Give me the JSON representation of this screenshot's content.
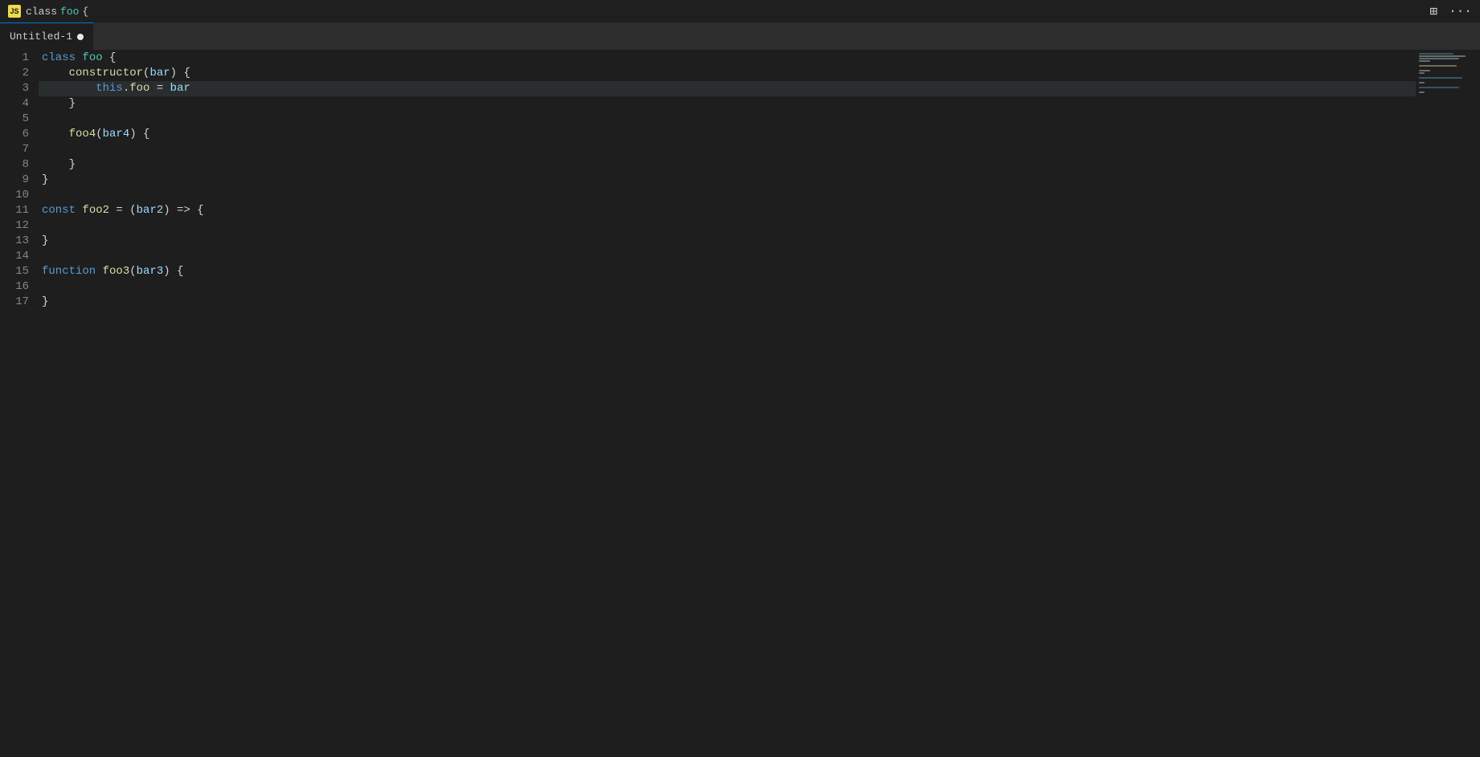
{
  "titleBar": {
    "jsIconLabel": "JS",
    "breadcrumb": {
      "classKeyword": "class",
      "className": "foo",
      "brace": "{"
    },
    "tabName": "Untitled-1",
    "tabModified": true
  },
  "icons": {
    "splitEditor": "⊞",
    "more": "···"
  },
  "lines": [
    {
      "num": 1,
      "content": "class foo {",
      "tokens": [
        {
          "t": "kw",
          "v": "class"
        },
        {
          "t": "text",
          "v": " "
        },
        {
          "t": "cn",
          "v": "foo"
        },
        {
          "t": "text",
          "v": " {"
        }
      ]
    },
    {
      "num": 2,
      "content": "    constructor(bar) {",
      "tokens": [
        {
          "t": "text",
          "v": "    "
        },
        {
          "t": "fn",
          "v": "constructor"
        },
        {
          "t": "punct",
          "v": "("
        },
        {
          "t": "param",
          "v": "bar"
        },
        {
          "t": "punct",
          "v": ") {"
        }
      ]
    },
    {
      "num": 3,
      "content": "        this.foo = bar",
      "tokens": [
        {
          "t": "text",
          "v": "        "
        },
        {
          "t": "kw-this",
          "v": "this"
        },
        {
          "t": "text",
          "v": "."
        },
        {
          "t": "fn",
          "v": "foo"
        },
        {
          "t": "text",
          "v": " = "
        },
        {
          "t": "param",
          "v": "bar"
        }
      ],
      "highlighted": true
    },
    {
      "num": 4,
      "content": "    }",
      "tokens": [
        {
          "t": "text",
          "v": "    }"
        }
      ]
    },
    {
      "num": 5,
      "content": "",
      "tokens": []
    },
    {
      "num": 6,
      "content": "    foo4(bar4) {",
      "tokens": [
        {
          "t": "text",
          "v": "    "
        },
        {
          "t": "fn",
          "v": "foo4"
        },
        {
          "t": "punct",
          "v": "("
        },
        {
          "t": "param",
          "v": "bar4"
        },
        {
          "t": "punct",
          "v": ") {"
        }
      ]
    },
    {
      "num": 7,
      "content": "",
      "tokens": []
    },
    {
      "num": 8,
      "content": "    }",
      "tokens": [
        {
          "t": "text",
          "v": "    }"
        }
      ]
    },
    {
      "num": 9,
      "content": "}",
      "tokens": [
        {
          "t": "text",
          "v": "}"
        }
      ]
    },
    {
      "num": 10,
      "content": "",
      "tokens": []
    },
    {
      "num": 11,
      "content": "const foo2 = (bar2) => {",
      "tokens": [
        {
          "t": "kw",
          "v": "const"
        },
        {
          "t": "text",
          "v": " "
        },
        {
          "t": "fn",
          "v": "foo2"
        },
        {
          "t": "text",
          "v": " = ("
        },
        {
          "t": "param",
          "v": "bar2"
        },
        {
          "t": "text",
          "v": ") => {"
        }
      ]
    },
    {
      "num": 12,
      "content": "",
      "tokens": []
    },
    {
      "num": 13,
      "content": "}",
      "tokens": [
        {
          "t": "text",
          "v": "}"
        }
      ]
    },
    {
      "num": 14,
      "content": "",
      "tokens": []
    },
    {
      "num": 15,
      "content": "function foo3(bar3) {",
      "tokens": [
        {
          "t": "kw",
          "v": "function"
        },
        {
          "t": "text",
          "v": " "
        },
        {
          "t": "fn",
          "v": "foo3"
        },
        {
          "t": "punct",
          "v": "("
        },
        {
          "t": "param",
          "v": "bar3"
        },
        {
          "t": "punct",
          "v": ") {"
        }
      ]
    },
    {
      "num": 16,
      "content": "",
      "tokens": []
    },
    {
      "num": 17,
      "content": "}",
      "tokens": [
        {
          "t": "text",
          "v": "}"
        }
      ]
    }
  ],
  "minimap": {
    "lines": [
      {
        "color": "#569cd6",
        "width": "60%"
      },
      {
        "color": "#dcdcaa",
        "width": "80%"
      },
      {
        "color": "#9cdcfe",
        "width": "70%"
      },
      {
        "color": "#d4d4d4",
        "width": "20%"
      },
      {
        "color": "transparent",
        "width": "0%"
      },
      {
        "color": "#dcdcaa",
        "width": "65%"
      },
      {
        "color": "transparent",
        "width": "0%"
      },
      {
        "color": "#d4d4d4",
        "width": "20%"
      },
      {
        "color": "#d4d4d4",
        "width": "10%"
      },
      {
        "color": "transparent",
        "width": "0%"
      },
      {
        "color": "#569cd6",
        "width": "75%"
      },
      {
        "color": "transparent",
        "width": "0%"
      },
      {
        "color": "#d4d4d4",
        "width": "10%"
      },
      {
        "color": "transparent",
        "width": "0%"
      },
      {
        "color": "#569cd6",
        "width": "70%"
      },
      {
        "color": "transparent",
        "width": "0%"
      },
      {
        "color": "#d4d4d4",
        "width": "10%"
      }
    ]
  }
}
